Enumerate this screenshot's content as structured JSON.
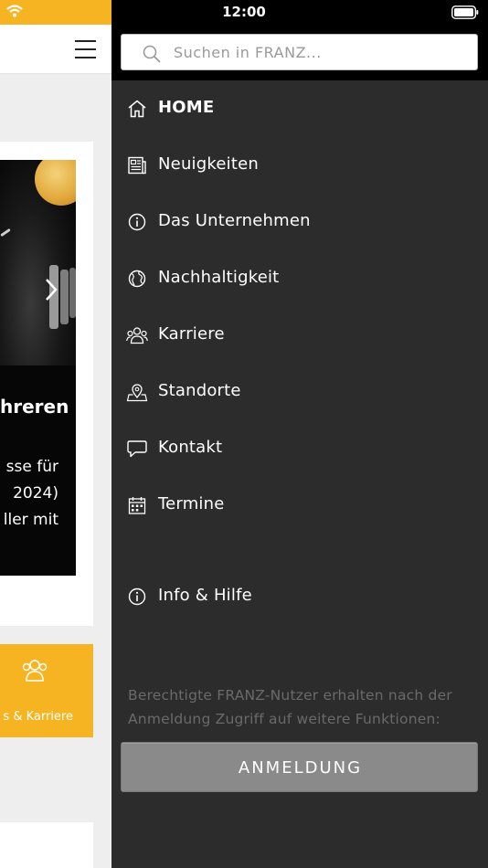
{
  "status_bar": {
    "time": "12:00"
  },
  "background_page": {
    "slide_title": "hreren",
    "slide_text_lines": [
      "sse  für",
      "  2024)",
      "ller mit"
    ],
    "tile_label": "s & Karriere"
  },
  "search": {
    "placeholder": "Suchen in FRANZ...",
    "value": ""
  },
  "menu": {
    "items": [
      {
        "label": "HOME",
        "icon": "home-icon",
        "active": true
      },
      {
        "label": "Neuigkeiten",
        "icon": "newspaper-icon"
      },
      {
        "label": "Das Unternehmen",
        "icon": "info-icon"
      },
      {
        "label": "Nachhaltigkeit",
        "icon": "globe-icon"
      },
      {
        "label": "Karriere",
        "icon": "people-icon"
      },
      {
        "label": "Standorte",
        "icon": "map-pin-icon"
      },
      {
        "label": "Kontakt",
        "icon": "chat-bubble-icon"
      },
      {
        "label": "Termine",
        "icon": "calendar-icon"
      }
    ],
    "info_item": {
      "label": "Info & Hilfe",
      "icon": "info-icon"
    }
  },
  "login_notice": "Berechtigte FRANZ-Nutzer erhalten nach der Anmeldung Zugriff auf weitere Funktionen:",
  "login_button": {
    "label": "ANMELDUNG"
  },
  "colors": {
    "brand_accent": "#f7b422",
    "drawer_background": "#2c2c2c",
    "search_area_background": "#000000",
    "login_button": "#8a8a8a"
  }
}
